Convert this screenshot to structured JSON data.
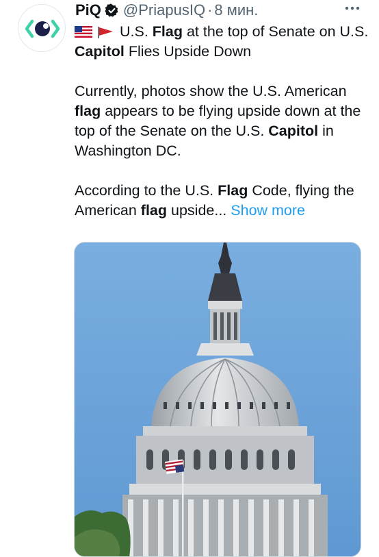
{
  "tweet": {
    "author_name": "PiQ",
    "handle": "@PriapusIQ",
    "separator": "·",
    "time": "8 мин.",
    "headline_part1": "U.S. ",
    "headline_bold1": "Flag",
    "headline_part2": " at the top of Senate on U.S. ",
    "headline_bold2": "Capitol",
    "headline_part3": " Flies Upside Down",
    "para2_part1": "Currently, photos show the U.S. American ",
    "para2_bold1": "flag",
    "para2_part2": " appears to be flying upside down at the top of the Senate on the U.S. ",
    "para2_bold2": "Capitol",
    "para2_part3": " in Washington DC.",
    "para3_part1": "According to the U.S. ",
    "para3_bold1": "Flag",
    "para3_part2": " Code, flying the American ",
    "para3_bold2": "flag",
    "para3_part3": " upside...",
    "show_more_label": "Show more"
  },
  "icons": {
    "avatar": "piq-logo-icon",
    "verified": "verified-badge-icon",
    "more": "more-options-icon",
    "flag_us": "us-flag-emoji-icon",
    "flag_triangular": "triangular-flag-emoji-icon"
  },
  "colors": {
    "link": "#1d9bf0",
    "secondary_text": "#536471",
    "primary_text": "#0f1419",
    "logo_accent": "#3fd2a8",
    "sky": "#6aa0d6"
  }
}
